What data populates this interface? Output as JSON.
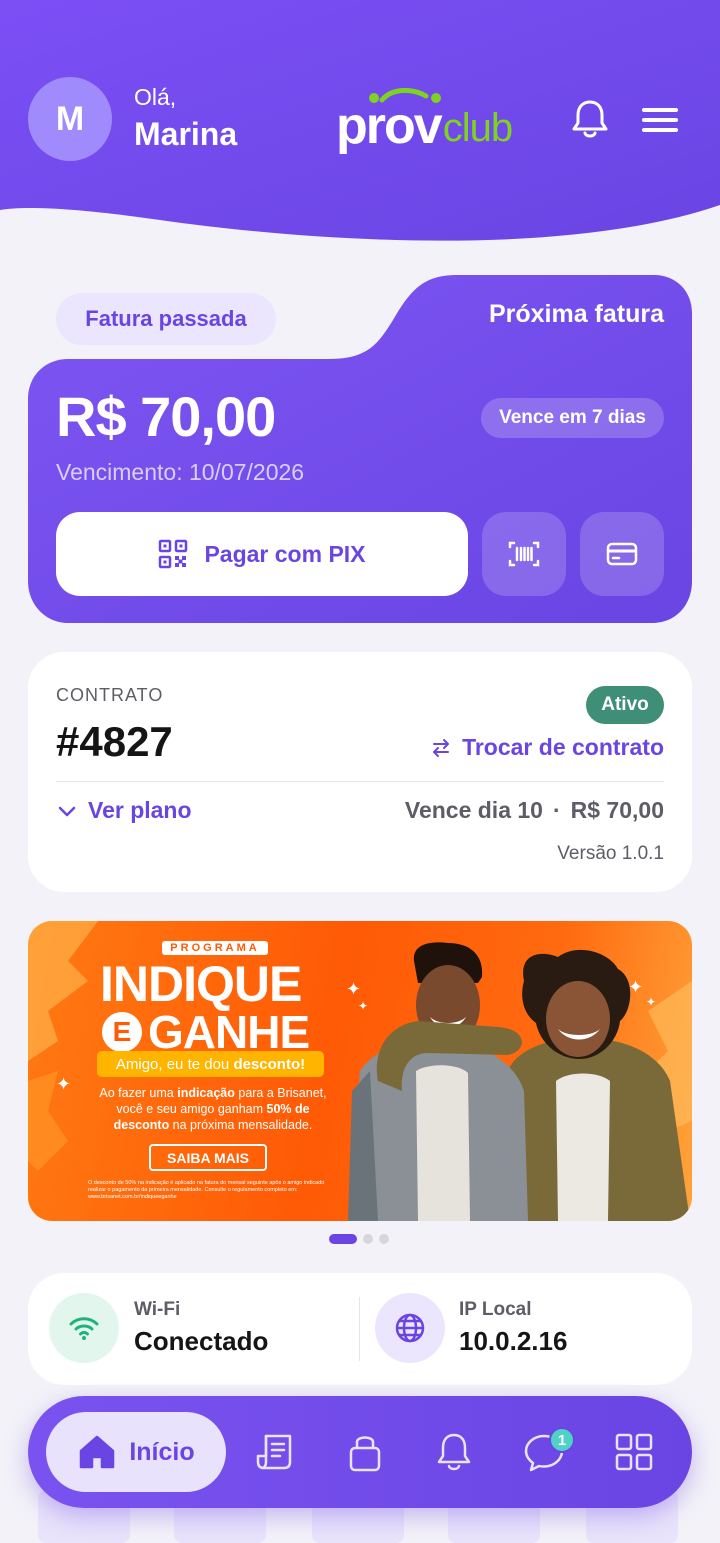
{
  "header": {
    "avatar_initial": "M",
    "greeting": "Olá,",
    "user_name": "Marina",
    "logo_text_1": "prov",
    "logo_text_2": "club",
    "icons": [
      "bell-icon",
      "menu-icon"
    ]
  },
  "invoice": {
    "tab_past": "Fatura passada",
    "tab_next": "Próxima fatura",
    "amount": "R$ 70,00",
    "due_badge": "Vence em 7 dias",
    "due_date": "Vencimento: 10/07/2026",
    "pix_label": "Pagar com PIX",
    "actions": [
      "qr-code-icon",
      "barcode-icon",
      "credit-card-icon"
    ]
  },
  "contract": {
    "label": "CONTRATO",
    "number": "#4827",
    "status": "Ativo",
    "switch_label": "Trocar de contrato",
    "plan_label": "Ver plano",
    "due_day": "Vence dia 10",
    "separator": "·",
    "price": "R$ 70,00",
    "version": "Versão 1.0.1"
  },
  "banner": {
    "program": "PROGRAMA",
    "title_1": "INDIQUE",
    "title_e": "E",
    "title_2": "GANHE",
    "friend_prefix": "Amigo, eu te dou ",
    "friend_bold": "desconto!",
    "desc_1": "Ao fazer uma ",
    "desc_bold_1": "indicação",
    "desc_2": " para a Brisanet, você e seu amigo ganham ",
    "desc_bold_2": "50% de desconto",
    "desc_3": " na próxima mensalidade.",
    "cta": "SAIBA MAIS",
    "legal": "O desconto de 50% na indicação é aplicado na fatura do mensal seguinte após o amigo indicado realizar o pagamento da primeira mensalidade. Consulte o regulamento completo em: www.brisanet.com.br/indiqueeganhe",
    "slides": 3,
    "active_slide": 1
  },
  "network": {
    "wifi_label": "Wi-Fi",
    "wifi_value": "Conectado",
    "ip_label": "IP Local",
    "ip_value": "10.0.2.16",
    "colors": {
      "wifi": "#1fb37a",
      "ip": "#6a45e3"
    }
  },
  "bottom_nav": {
    "home_label": "Início",
    "items": [
      "home-icon",
      "receipt-icon",
      "lock-icon",
      "bell-icon",
      "chat-icon",
      "grid-icon"
    ],
    "chat_badge": "1"
  },
  "colors": {
    "primary": "#6a45e3",
    "primary_light": "#ebe6fd",
    "background": "#f3f2f8",
    "success": "#3f8f77",
    "banner_orange": "#ff5a06",
    "logo_green": "#7ed321"
  }
}
